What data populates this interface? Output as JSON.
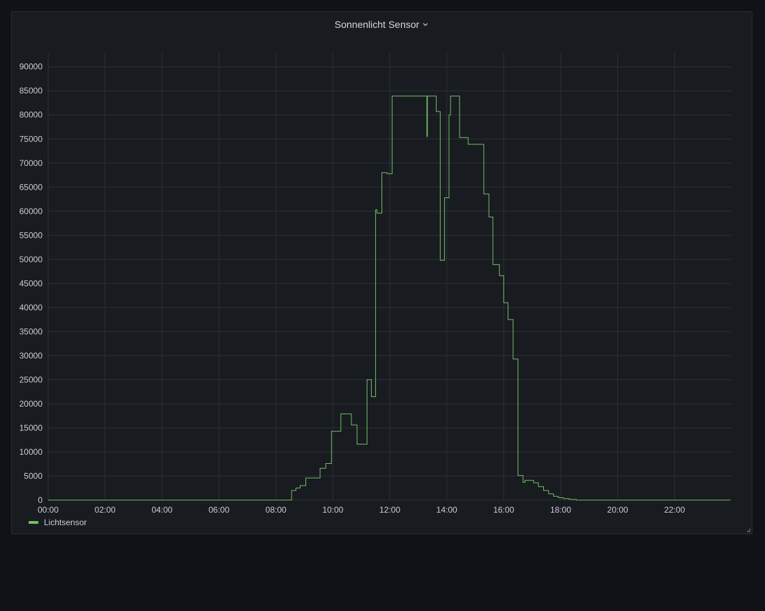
{
  "panel": {
    "title": "Sonnenlicht Sensor",
    "menu_icon": "chevron-down-icon",
    "resize_icon": "resize-corner-icon"
  },
  "colors": {
    "background": "#111217",
    "panel": "#181b1f",
    "grid": "#2c2f35",
    "axis_text": "#ccccdc",
    "series": "#73bf69"
  },
  "chart_data": {
    "type": "line",
    "title": "Sonnenlicht Sensor",
    "xlabel": "",
    "ylabel": "",
    "x_unit": "hour of day",
    "xlim": [
      0,
      24
    ],
    "ylim": [
      0,
      93000
    ],
    "grid": true,
    "legend": "bottom-left",
    "x_ticks": [
      "00:00",
      "02:00",
      "04:00",
      "06:00",
      "08:00",
      "10:00",
      "12:00",
      "14:00",
      "16:00",
      "18:00",
      "20:00",
      "22:00"
    ],
    "y_ticks": [
      0,
      5000,
      10000,
      15000,
      20000,
      25000,
      30000,
      35000,
      40000,
      45000,
      50000,
      55000,
      60000,
      65000,
      70000,
      75000,
      80000,
      85000,
      90000
    ],
    "series": [
      {
        "name": "Lichtsensor",
        "color": "#73bf69",
        "step": "after",
        "points": [
          [
            0,
            0
          ],
          [
            8.55,
            0
          ],
          [
            8.55,
            2000
          ],
          [
            8.7,
            2500
          ],
          [
            8.85,
            3000
          ],
          [
            9.05,
            4600
          ],
          [
            9.55,
            6600
          ],
          [
            9.75,
            7600
          ],
          [
            9.95,
            14300
          ],
          [
            10.28,
            17900
          ],
          [
            10.65,
            15600
          ],
          [
            10.85,
            11600
          ],
          [
            11.2,
            25000
          ],
          [
            11.35,
            21500
          ],
          [
            11.5,
            60300
          ],
          [
            11.55,
            59600
          ],
          [
            11.72,
            68000
          ],
          [
            11.9,
            67800
          ],
          [
            12.08,
            83900
          ],
          [
            13.3,
            75500
          ],
          [
            13.32,
            83900
          ],
          [
            13.63,
            80700
          ],
          [
            13.77,
            49800
          ],
          [
            13.92,
            62800
          ],
          [
            14.08,
            80000
          ],
          [
            14.13,
            83900
          ],
          [
            14.45,
            75300
          ],
          [
            14.75,
            73900
          ],
          [
            15.3,
            63600
          ],
          [
            15.48,
            58800
          ],
          [
            15.62,
            48900
          ],
          [
            15.85,
            46600
          ],
          [
            16.0,
            41000
          ],
          [
            16.15,
            37500
          ],
          [
            16.33,
            29300
          ],
          [
            16.5,
            5100
          ],
          [
            16.68,
            3700
          ],
          [
            16.75,
            4100
          ],
          [
            17.05,
            3600
          ],
          [
            17.22,
            2800
          ],
          [
            17.4,
            2000
          ],
          [
            17.58,
            1300
          ],
          [
            17.75,
            800
          ],
          [
            17.92,
            500
          ],
          [
            18.1,
            300
          ],
          [
            18.3,
            150
          ],
          [
            18.55,
            0
          ],
          [
            23.95,
            0
          ]
        ]
      }
    ]
  }
}
